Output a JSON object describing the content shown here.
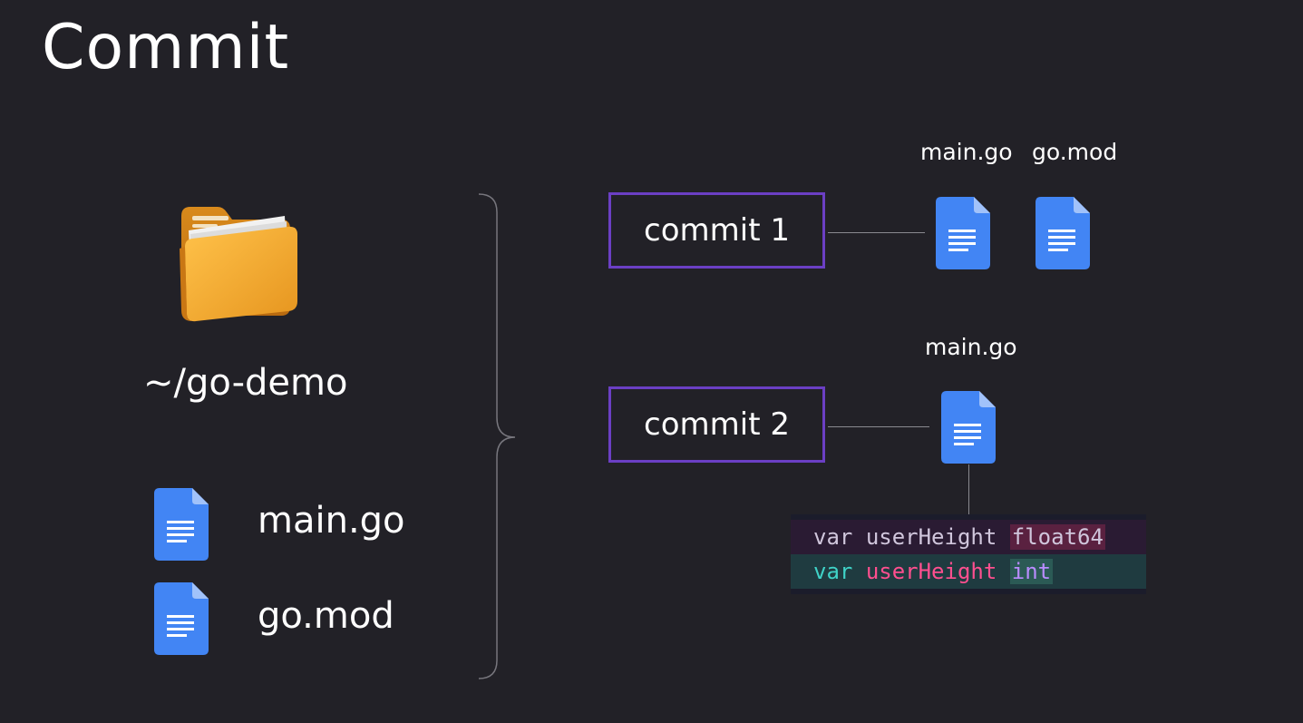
{
  "slide": {
    "title": "Commit"
  },
  "left": {
    "folder_label": "~/go-demo",
    "files": [
      {
        "name": "main.go"
      },
      {
        "name": "go.mod"
      }
    ]
  },
  "commits": [
    {
      "label": "commit 1",
      "files": [
        "main.go",
        "go.mod"
      ]
    },
    {
      "label": "commit 2",
      "files": [
        "main.go"
      ]
    }
  ],
  "diff": {
    "removed": {
      "keyword": "var",
      "identifier": "userHeight",
      "type": "float64"
    },
    "added": {
      "keyword": "var",
      "identifier": "userHeight",
      "type": "int"
    }
  },
  "colors": {
    "background": "#222127",
    "commit_border": "#6b3fc4",
    "doc_icon": "#4285f4",
    "folder": "#f0a52a"
  },
  "icons": {
    "folder": "folder-icon",
    "document": "document-icon"
  }
}
